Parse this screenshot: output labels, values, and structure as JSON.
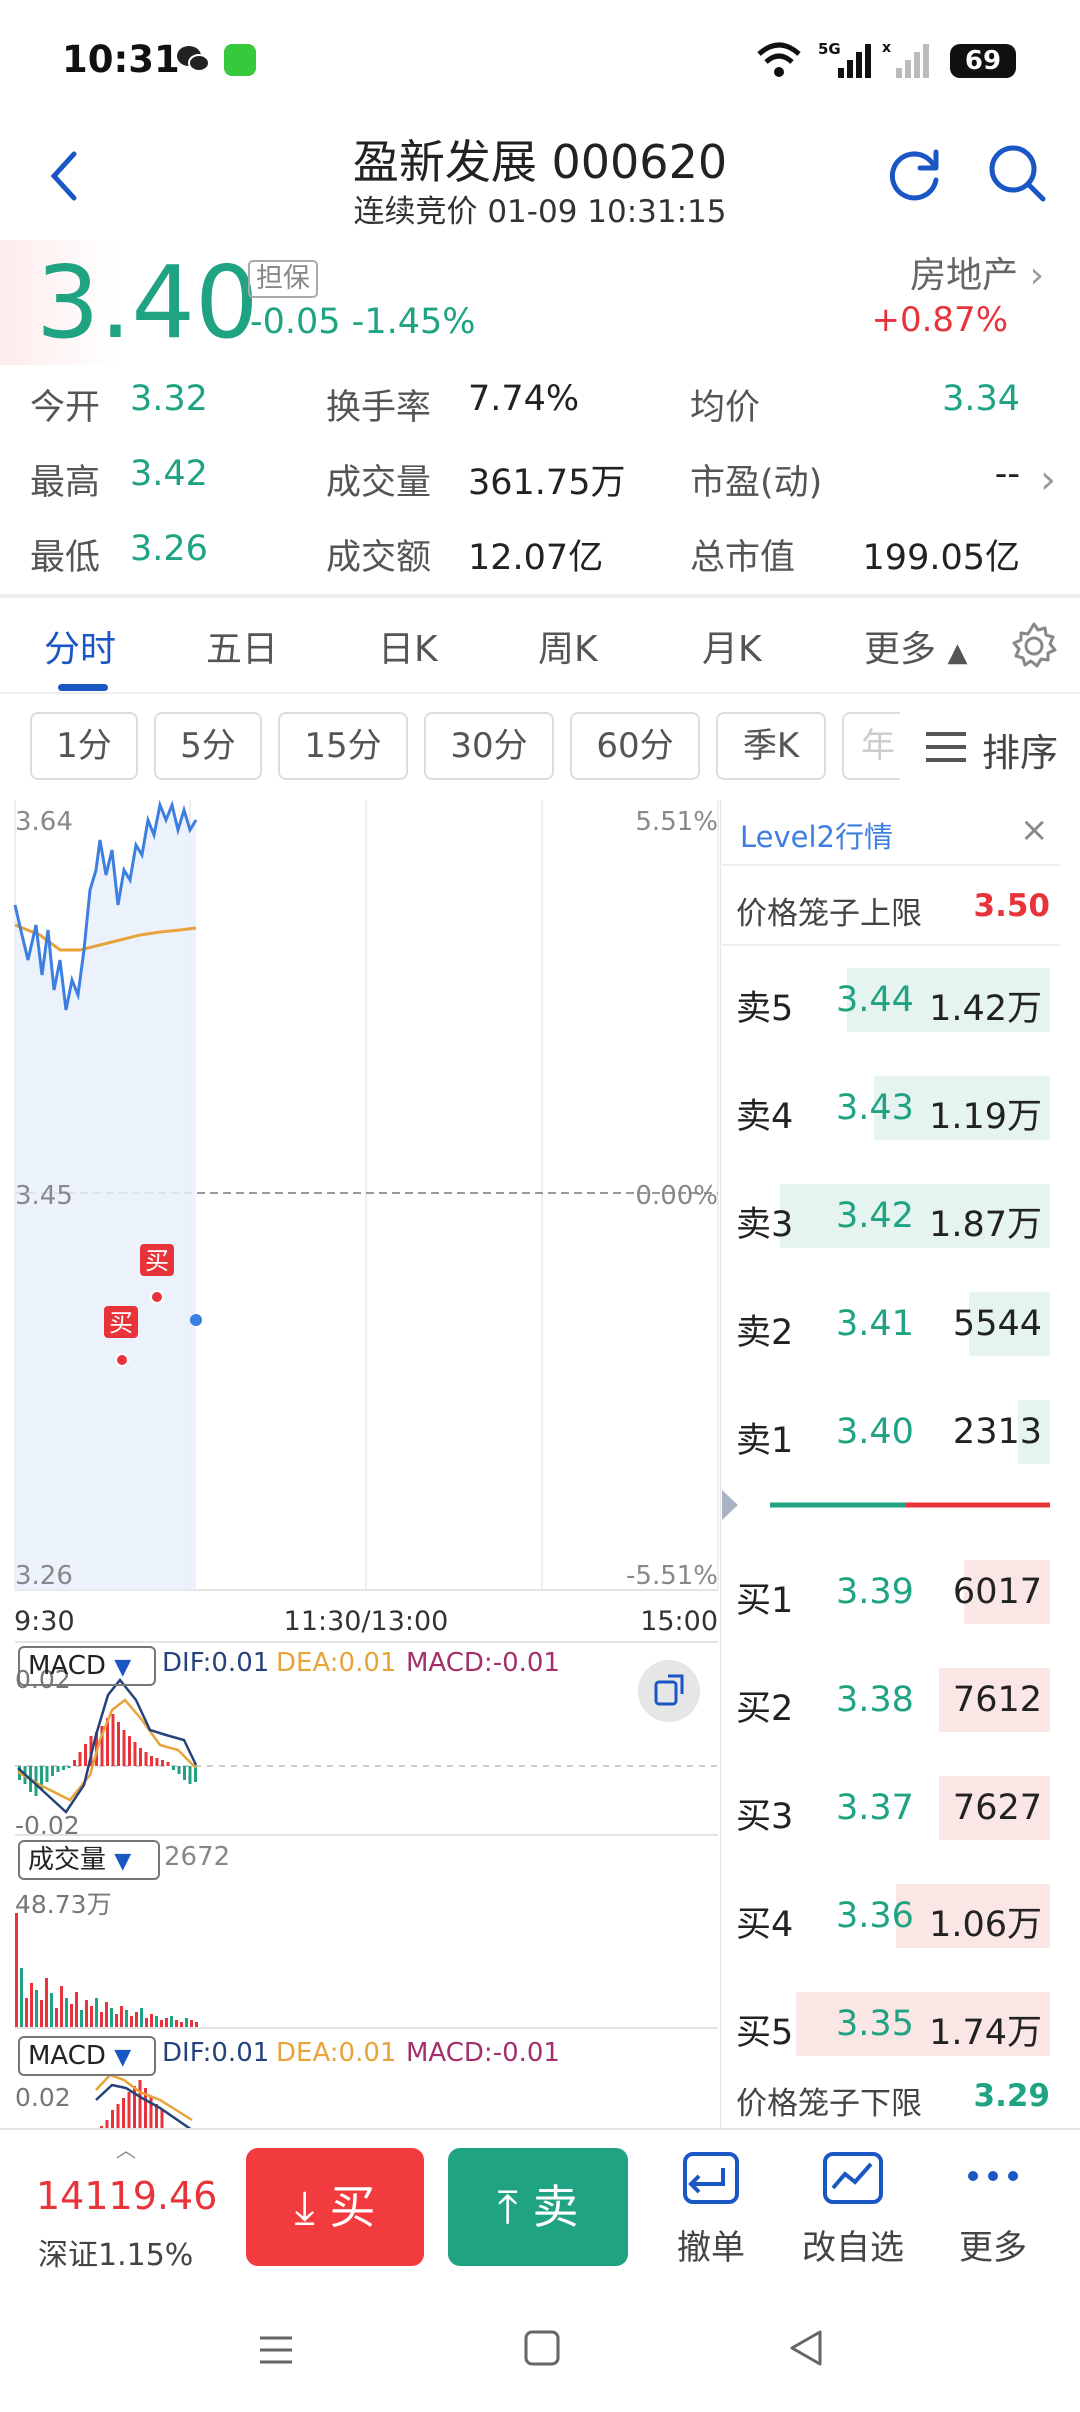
{
  "status_bar": {
    "time": "10:31",
    "battery": "69"
  },
  "header": {
    "title": "盈新发展 000620",
    "subtitle": "连续竞价 01-09 10:31:15"
  },
  "quote": {
    "price": "3.40",
    "tag": "担保",
    "change": "-0.05 -1.45%",
    "sector": "房地产",
    "sector_change": "+0.87%"
  },
  "stats": [
    {
      "label": "今开",
      "value": "3.32"
    },
    {
      "label": "换手率",
      "value": "7.74%"
    },
    {
      "label": "均价",
      "value": "3.34"
    },
    {
      "label": "最高",
      "value": "3.42"
    },
    {
      "label": "成交量",
      "value": "361.75万"
    },
    {
      "label": "市盈(动)",
      "value": "--"
    },
    {
      "label": "最低",
      "value": "3.26"
    },
    {
      "label": "成交额",
      "value": "12.07亿"
    },
    {
      "label": "总市值",
      "value": "199.05亿"
    }
  ],
  "tabs": [
    "分时",
    "五日",
    "日K",
    "周K",
    "月K",
    "更多"
  ],
  "periods": [
    "1分",
    "5分",
    "15分",
    "30分",
    "60分",
    "季K",
    "年"
  ],
  "sort_label": "排序",
  "chart": {
    "price_top": "3.64",
    "price_mid": "3.45",
    "price_bottom": "3.26",
    "pct_top": "5.51%",
    "pct_mid": "0.00%",
    "pct_bottom": "-5.51%",
    "time_start": "9:30",
    "time_mid": "11:30/13:00",
    "time_end": "15:00",
    "buy_marker": "买"
  },
  "macd": {
    "name": "MACD",
    "dif": "DIF:0.01",
    "dea": "DEA:0.01",
    "macd": "MACD:-0.01",
    "top": "0.02",
    "bottom": "-0.02"
  },
  "volume": {
    "name": "成交量",
    "last": "2672",
    "max": "48.73万"
  },
  "level2": {
    "title": "Level2行情",
    "upper_label": "价格笼子上限",
    "upper_value": "3.50",
    "lower_label": "价格笼子下限",
    "lower_value": "3.29",
    "asks": [
      {
        "label": "卖5",
        "price": "3.44",
        "vol": "1.42万",
        "depth": 0.75
      },
      {
        "label": "卖4",
        "price": "3.43",
        "vol": "1.19万",
        "depth": 0.65
      },
      {
        "label": "卖3",
        "price": "3.42",
        "vol": "1.87万",
        "depth": 1.0
      },
      {
        "label": "卖2",
        "price": "3.41",
        "vol": "5544",
        "depth": 0.3
      },
      {
        "label": "卖1",
        "price": "3.40",
        "vol": "2313",
        "depth": 0.12
      }
    ],
    "bids": [
      {
        "label": "买1",
        "price": "3.39",
        "vol": "6017",
        "depth": 0.32
      },
      {
        "label": "买2",
        "price": "3.38",
        "vol": "7612",
        "depth": 0.41
      },
      {
        "label": "买3",
        "price": "3.37",
        "vol": "7627",
        "depth": 0.41
      },
      {
        "label": "买4",
        "price": "3.36",
        "vol": "1.06万",
        "depth": 0.57
      },
      {
        "label": "买5",
        "price": "3.35",
        "vol": "1.74万",
        "depth": 0.94
      }
    ]
  },
  "bottom": {
    "index_value": "14119.46",
    "index_change": "深证1.15%",
    "buy": "买",
    "sell": "卖",
    "cancel": "撤单",
    "watch": "改自选",
    "more": "更多"
  },
  "colors": {
    "up": "#e8333b",
    "down": "#1fa383",
    "accent": "#1a56c4",
    "avg_line": "#e8a33a",
    "price_line": "#3d7fe0"
  }
}
